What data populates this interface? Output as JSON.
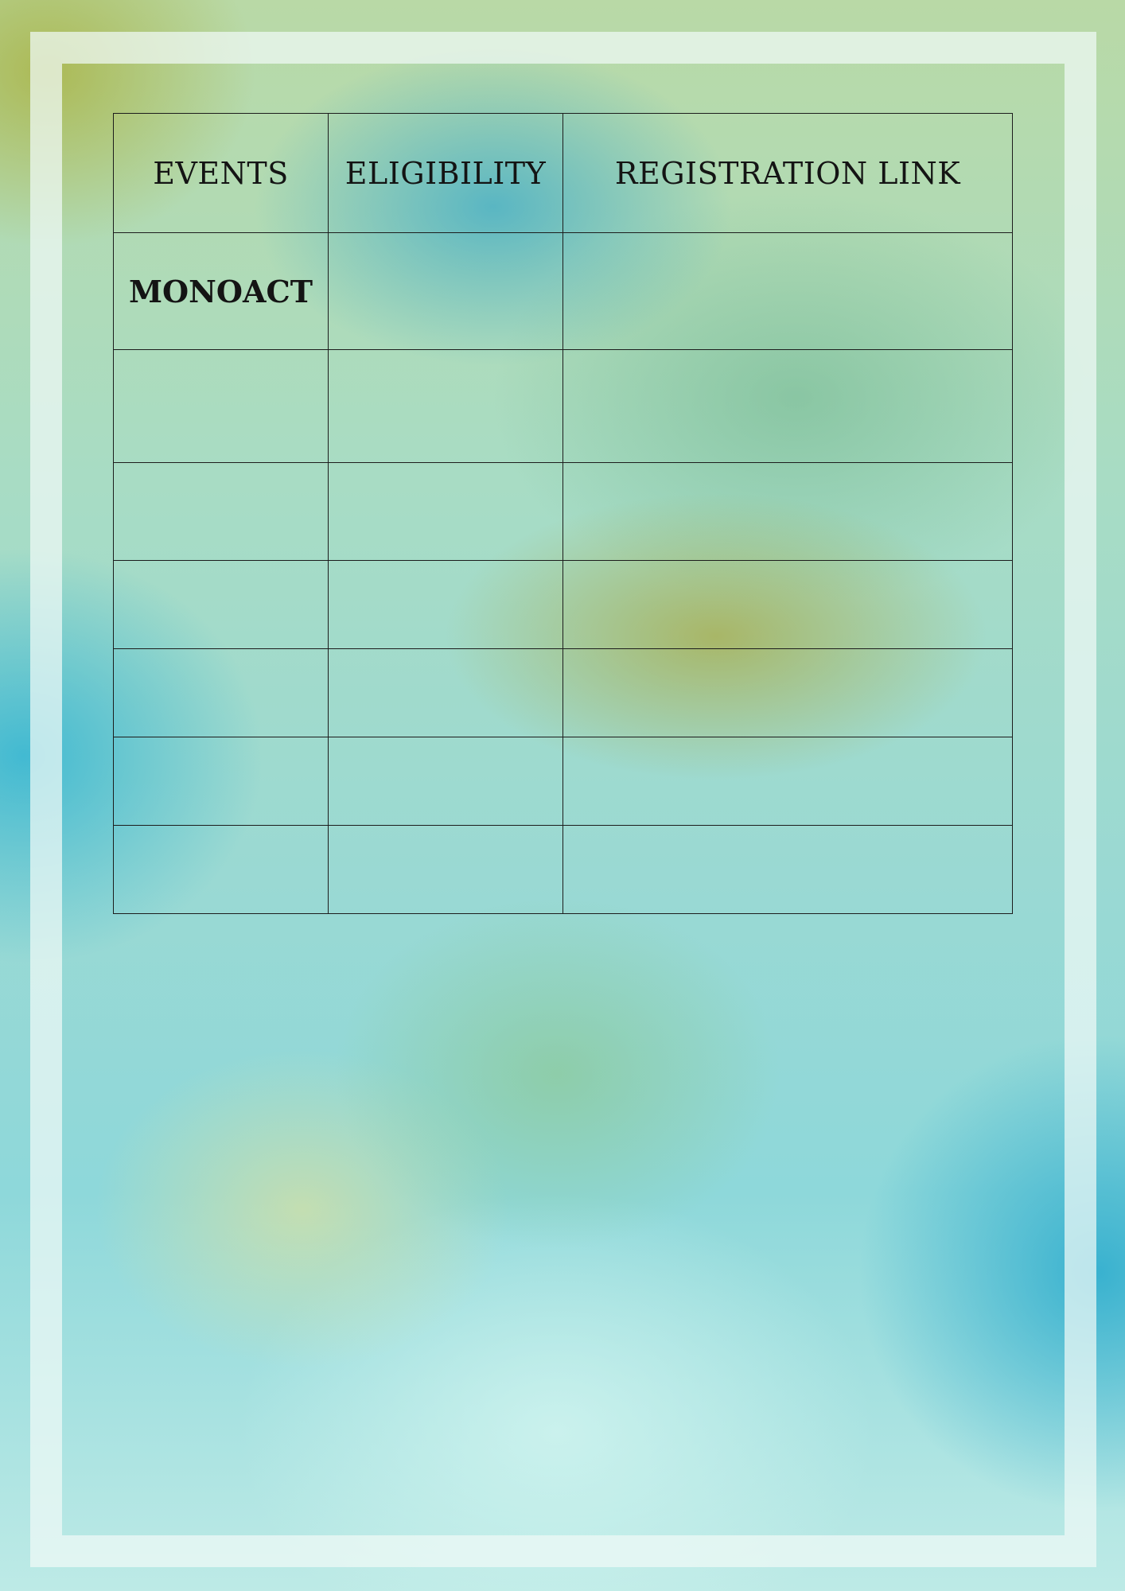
{
  "table": {
    "headers": [
      "EVENTS",
      "ELIGIBILITY",
      "REGISTRATION LINK"
    ],
    "rows": [
      [
        "MONOACT",
        "",
        ""
      ],
      [
        "",
        "",
        ""
      ],
      [
        "",
        "",
        ""
      ],
      [
        "",
        "",
        ""
      ],
      [
        "",
        "",
        ""
      ],
      [
        "",
        "",
        ""
      ],
      [
        "",
        "",
        ""
      ]
    ]
  },
  "colors": {
    "border": "#1c1c1c",
    "text": "#141414",
    "frame": "#f0faf6"
  }
}
